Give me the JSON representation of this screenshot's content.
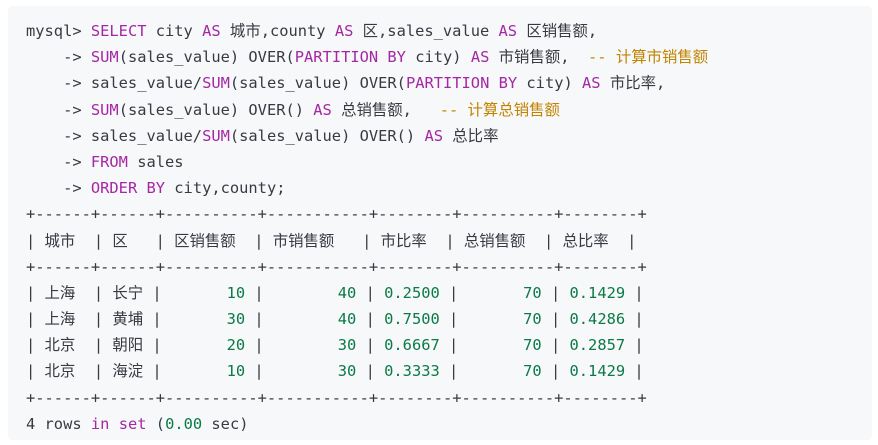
{
  "lines": [
    [
      {
        "t": "mysql> ",
        "c": "pl"
      },
      {
        "t": "SELECT",
        "c": "kw"
      },
      {
        "t": " city ",
        "c": "pl"
      },
      {
        "t": "AS",
        "c": "kw"
      },
      {
        "t": " 城市,county ",
        "c": "pl"
      },
      {
        "t": "AS",
        "c": "kw"
      },
      {
        "t": " 区,sales_value ",
        "c": "pl"
      },
      {
        "t": "AS",
        "c": "kw"
      },
      {
        "t": " 区销售额,",
        "c": "pl"
      }
    ],
    [
      {
        "t": "    -> ",
        "c": "pl"
      },
      {
        "t": "SUM",
        "c": "kw"
      },
      {
        "t": "(sales_value) OVER(",
        "c": "pl"
      },
      {
        "t": "PARTITION BY",
        "c": "kw"
      },
      {
        "t": " city) ",
        "c": "pl"
      },
      {
        "t": "AS",
        "c": "kw"
      },
      {
        "t": " 市销售额,  ",
        "c": "pl"
      },
      {
        "t": "-- 计算市销售额",
        "c": "cm"
      }
    ],
    [
      {
        "t": "    -> sales_value/",
        "c": "pl"
      },
      {
        "t": "SUM",
        "c": "kw"
      },
      {
        "t": "(sales_value) OVER(",
        "c": "pl"
      },
      {
        "t": "PARTITION BY",
        "c": "kw"
      },
      {
        "t": " city) ",
        "c": "pl"
      },
      {
        "t": "AS",
        "c": "kw"
      },
      {
        "t": " 市比率,",
        "c": "pl"
      }
    ],
    [
      {
        "t": "    -> ",
        "c": "pl"
      },
      {
        "t": "SUM",
        "c": "kw"
      },
      {
        "t": "(sales_value) OVER() ",
        "c": "pl"
      },
      {
        "t": "AS",
        "c": "kw"
      },
      {
        "t": " 总销售额,   ",
        "c": "pl"
      },
      {
        "t": "-- 计算总销售额",
        "c": "cm"
      }
    ],
    [
      {
        "t": "    -> sales_value/",
        "c": "pl"
      },
      {
        "t": "SUM",
        "c": "kw"
      },
      {
        "t": "(sales_value) OVER() ",
        "c": "pl"
      },
      {
        "t": "AS",
        "c": "kw"
      },
      {
        "t": " 总比率",
        "c": "pl"
      }
    ],
    [
      {
        "t": "    -> ",
        "c": "pl"
      },
      {
        "t": "FROM",
        "c": "kw"
      },
      {
        "t": " sales",
        "c": "pl"
      }
    ],
    [
      {
        "t": "    -> ",
        "c": "pl"
      },
      {
        "t": "ORDER BY",
        "c": "kw"
      },
      {
        "t": " city,county;",
        "c": "pl"
      }
    ],
    [
      {
        "t": "+------+------+----------+-----------+--------+----------+--------+",
        "c": "pl"
      }
    ],
    [
      {
        "t": "| 城市  | 区   | 区销售额  | 市销售额   | 市比率  | 总销售额  | 总比率  |",
        "c": "pl"
      }
    ],
    [
      {
        "t": "+------+------+----------+-----------+--------+----------+--------+",
        "c": "pl"
      }
    ],
    [
      {
        "t": "| 上海  | 长宁 |       ",
        "c": "pl"
      },
      {
        "t": "10",
        "c": "num"
      },
      {
        "t": " |        ",
        "c": "pl"
      },
      {
        "t": "40",
        "c": "num"
      },
      {
        "t": " | ",
        "c": "pl"
      },
      {
        "t": "0.2500",
        "c": "num"
      },
      {
        "t": " |       ",
        "c": "pl"
      },
      {
        "t": "70",
        "c": "num"
      },
      {
        "t": " | ",
        "c": "pl"
      },
      {
        "t": "0.1429",
        "c": "num"
      },
      {
        "t": " |",
        "c": "pl"
      }
    ],
    [
      {
        "t": "| 上海  | 黄埔 |       ",
        "c": "pl"
      },
      {
        "t": "30",
        "c": "num"
      },
      {
        "t": " |        ",
        "c": "pl"
      },
      {
        "t": "40",
        "c": "num"
      },
      {
        "t": " | ",
        "c": "pl"
      },
      {
        "t": "0.7500",
        "c": "num"
      },
      {
        "t": " |       ",
        "c": "pl"
      },
      {
        "t": "70",
        "c": "num"
      },
      {
        "t": " | ",
        "c": "pl"
      },
      {
        "t": "0.4286",
        "c": "num"
      },
      {
        "t": " |",
        "c": "pl"
      }
    ],
    [
      {
        "t": "| 北京  | 朝阳 |       ",
        "c": "pl"
      },
      {
        "t": "20",
        "c": "num"
      },
      {
        "t": " |        ",
        "c": "pl"
      },
      {
        "t": "30",
        "c": "num"
      },
      {
        "t": " | ",
        "c": "pl"
      },
      {
        "t": "0.6667",
        "c": "num"
      },
      {
        "t": " |       ",
        "c": "pl"
      },
      {
        "t": "70",
        "c": "num"
      },
      {
        "t": " | ",
        "c": "pl"
      },
      {
        "t": "0.2857",
        "c": "num"
      },
      {
        "t": " |",
        "c": "pl"
      }
    ],
    [
      {
        "t": "| 北京  | 海淀 |       ",
        "c": "pl"
      },
      {
        "t": "10",
        "c": "num"
      },
      {
        "t": " |        ",
        "c": "pl"
      },
      {
        "t": "30",
        "c": "num"
      },
      {
        "t": " | ",
        "c": "pl"
      },
      {
        "t": "0.3333",
        "c": "num"
      },
      {
        "t": " |       ",
        "c": "pl"
      },
      {
        "t": "70",
        "c": "num"
      },
      {
        "t": " | ",
        "c": "pl"
      },
      {
        "t": "0.1429",
        "c": "num"
      },
      {
        "t": " |",
        "c": "pl"
      }
    ],
    [
      {
        "t": "+------+------+----------+-----------+--------+----------+--------+",
        "c": "pl"
      }
    ],
    [
      {
        "t": "4 rows ",
        "c": "pl"
      },
      {
        "t": "in",
        "c": "kw"
      },
      {
        "t": " ",
        "c": "pl"
      },
      {
        "t": "set",
        "c": "kw"
      },
      {
        "t": " (",
        "c": "pl"
      },
      {
        "t": "0.00",
        "c": "num"
      },
      {
        "t": " sec)",
        "c": "pl"
      }
    ]
  ],
  "colors": {
    "background": "#f6f8fa",
    "keyword": "#a626a4",
    "comment": "#c18401",
    "number": "#0b7a46",
    "text": "#383a42"
  }
}
